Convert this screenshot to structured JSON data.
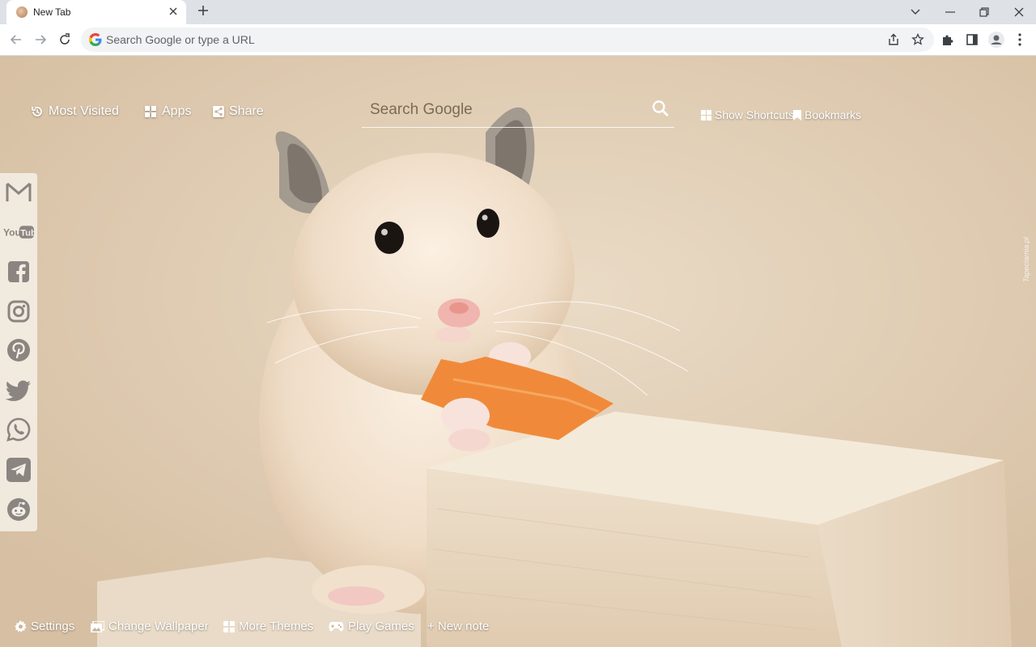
{
  "browser": {
    "tab_title": "New Tab",
    "omnibox_placeholder": "Search Google or type a URL"
  },
  "topnav": {
    "most_visited": "Most Visited",
    "apps": "Apps",
    "share": "Share"
  },
  "search": {
    "placeholder": "Search Google"
  },
  "right_links": {
    "show_shortcuts": "Show Shortcuts",
    "bookmarks": "Bookmarks"
  },
  "sidebar": {
    "items": [
      "gmail-icon",
      "youtube-icon",
      "facebook-icon",
      "instagram-icon",
      "pinterest-icon",
      "twitter-icon",
      "whatsapp-icon",
      "telegram-icon",
      "reddit-icon"
    ],
    "youtube_text": "YouTube"
  },
  "bottom": {
    "settings": "Settings",
    "change_wallpaper": "Change Wallpaper",
    "more_themes": "More Themes",
    "play_games": "Play Games",
    "new_note": "+ New note"
  },
  "watermark": "Tapeciarnia.pl",
  "colors": {
    "chrome_bg": "#dee1e6",
    "omnibox_bg": "#f1f3f4",
    "wallpaper_tone": "#e3d0b7",
    "carrot": "#f08a3a"
  }
}
